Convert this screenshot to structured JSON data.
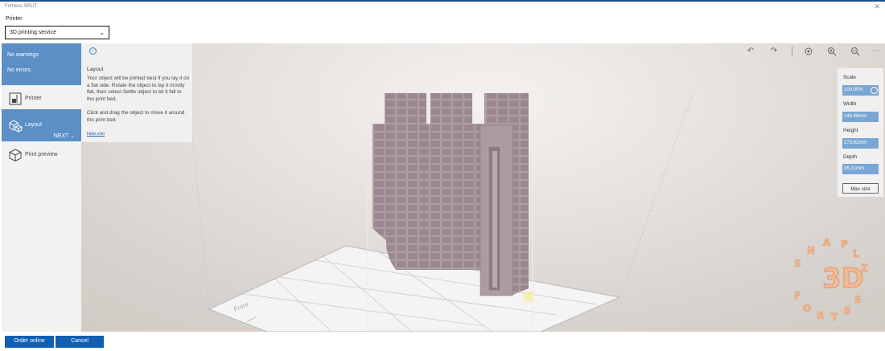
{
  "window": {
    "title": "Fortress SPLIT",
    "close_glyph": "✕"
  },
  "printer": {
    "label": "Printer",
    "selected": "3D printing service"
  },
  "status": {
    "warnings": "No warnings",
    "errors": "No errors"
  },
  "nav": {
    "printer": "Printer",
    "layout": "Layout",
    "next": "NEXT",
    "print_preview": "Print preview"
  },
  "info": {
    "title": "Layout",
    "paragraph1": "Your object will be printed best if you lay it on a flat side. Rotate the object to lay it mostly flat, then select Settle object to let it fall to the print bed.",
    "paragraph2": "Click and drag the object to move it around the print bed.",
    "hide_link": "Hide info"
  },
  "toolbar": {
    "undo_icon": "undo-icon",
    "redo_icon": "redo-icon",
    "view_icon": "view-icon",
    "zoom_in_icon": "zoom-in-icon",
    "zoom_out_icon": "zoom-out-icon",
    "more_icon": "more-icon"
  },
  "properties": {
    "scale_label": "Scale",
    "scale_value": "100.00%",
    "width_label": "Width",
    "width_value": "144.46mm",
    "height_label": "Height",
    "height_value": "173.62mm",
    "depth_label": "Depth",
    "depth_value": "36.31mm",
    "max_size_label": "Max size"
  },
  "bed": {
    "front_label": "Front"
  },
  "footer": {
    "order_label": "Order online",
    "cancel_label": "Cancel"
  },
  "colors": {
    "accent": "#5b8fc6",
    "primary_button": "#0f5fb3",
    "model": "#a7959c"
  }
}
